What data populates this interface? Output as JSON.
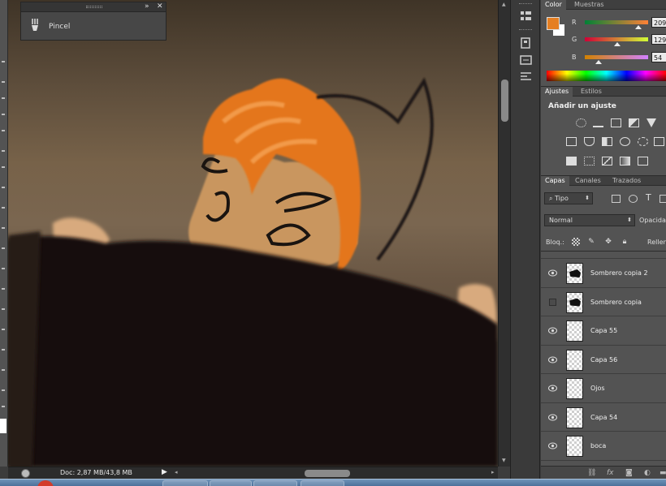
{
  "floating_panel": {
    "tool_label": "Pincel",
    "collapse_glyph": "»",
    "close_glyph": "✕",
    "icon": "brush-preset-icon"
  },
  "status_bar": {
    "doc_info": "Doc: 2,87 MB/43,8 MB",
    "play_glyph": "▶",
    "left_arrow": "◂",
    "right_arrow": "▸"
  },
  "color_panel": {
    "tabs": [
      "Color",
      "Muestras"
    ],
    "foreground": "#e57f22",
    "background": "#ffffff",
    "sliders": [
      {
        "label": "R",
        "value": "209",
        "fraction": 0.82
      },
      {
        "label": "G",
        "value": "129",
        "fraction": 0.51
      },
      {
        "label": "B",
        "value": "54",
        "fraction": 0.21
      }
    ]
  },
  "adjustments_panel": {
    "tabs": [
      "Ajustes",
      "Estilos"
    ],
    "title": "Añadir un ajuste"
  },
  "layers_panel": {
    "tabs": [
      "Capas",
      "Canales",
      "Trazados"
    ],
    "filter_label": "⌕ Tipo",
    "blend_mode": "Normal",
    "opacity_label": "Opacidad:",
    "lock_label": "Bloq.:",
    "fill_label": "Relleno:",
    "layers": [
      {
        "name": "Sombrero copia 2",
        "visible": true,
        "thumb": "hat"
      },
      {
        "name": "Sombrero copia",
        "visible": false,
        "thumb": "hat"
      },
      {
        "name": "Capa 55",
        "visible": true,
        "thumb": "empty"
      },
      {
        "name": "Capa 56",
        "visible": true,
        "thumb": "empty"
      },
      {
        "name": "Ojos",
        "visible": true,
        "thumb": "empty"
      },
      {
        "name": "Capa 54",
        "visible": true,
        "thumb": "empty"
      },
      {
        "name": "boca",
        "visible": true,
        "thumb": "empty"
      }
    ]
  }
}
